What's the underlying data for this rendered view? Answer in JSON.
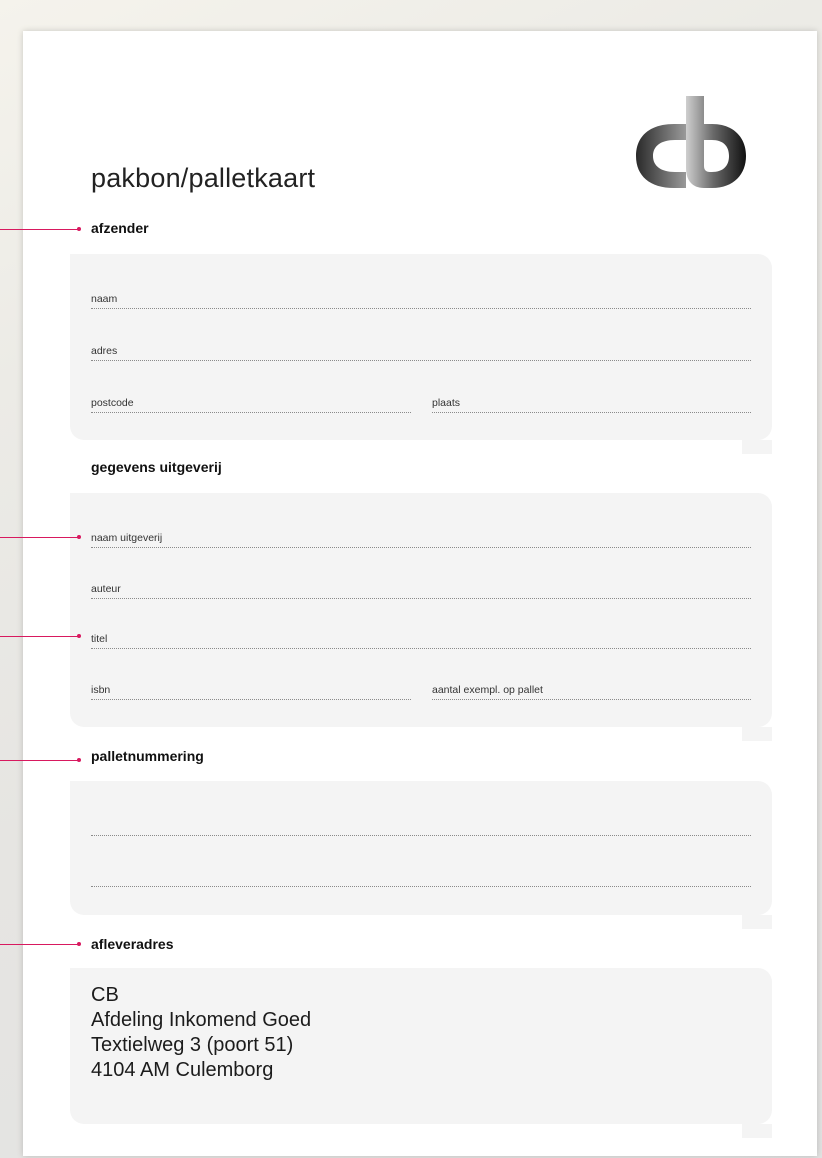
{
  "document": {
    "title": "pakbon/palletkaart"
  },
  "logo": {
    "name": "cb-logo-icon"
  },
  "sections": {
    "afzender": {
      "heading": "afzender",
      "fields": {
        "naam": "naam",
        "adres": "adres",
        "postcode": "postcode",
        "plaats": "plaats"
      }
    },
    "uitgeverij": {
      "heading": "gegevens uitgeverij",
      "fields": {
        "naam_uitgeverij": "naam uitgeverij",
        "auteur": "auteur",
        "titel": "titel",
        "isbn": "isbn",
        "aantal": "aantal exempl. op pallet"
      }
    },
    "palletnummering": {
      "heading": "palletnummering"
    },
    "afleveradres": {
      "heading": "afleveradres",
      "lines": [
        "CB",
        "Afdeling Inkomend Goed",
        "Textielweg 3 (poort 51)",
        "4104 AM  Culemborg"
      ]
    }
  },
  "colors": {
    "accent": "#d8195f",
    "panel": "#f4f4f4",
    "sheet": "#ffffff"
  }
}
